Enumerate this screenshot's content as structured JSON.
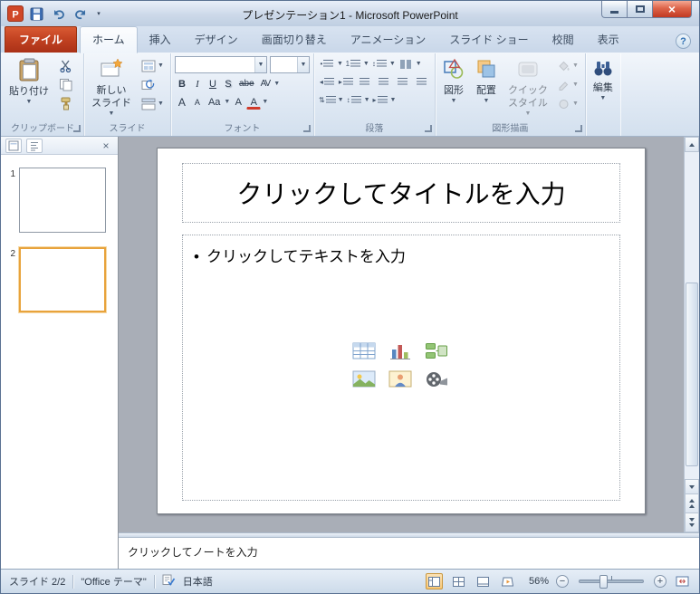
{
  "window": {
    "title": "プレゼンテーション1 - Microsoft PowerPoint"
  },
  "tabs": {
    "file": "ファイル",
    "items": [
      "ホーム",
      "挿入",
      "デザイン",
      "画面切り替え",
      "アニメーション",
      "スライド ショー",
      "校閲",
      "表示"
    ]
  },
  "ribbon": {
    "clipboard": {
      "group_label": "クリップボード",
      "paste_label": "貼り付け"
    },
    "slides": {
      "group_label": "スライド",
      "new_slide_line1": "新しい",
      "new_slide_line2": "スライド"
    },
    "font": {
      "group_label": "フォント",
      "font_name_value": "",
      "font_size_value": "",
      "bold": "B",
      "italic": "I",
      "underline": "U",
      "shadow": "S",
      "strikethrough": "abe",
      "spacing": "AV",
      "grow": "A",
      "shrink": "A",
      "case": "Aa",
      "clear": "A",
      "color": "A"
    },
    "paragraph": {
      "group_label": "段落"
    },
    "drawing": {
      "group_label": "図形描画",
      "shapes_label": "図形",
      "arrange_label": "配置",
      "quick_styles_line1": "クイック",
      "quick_styles_line2": "スタイル"
    },
    "editing": {
      "button_label": "編集"
    }
  },
  "slide_panel": {
    "thumbnails": [
      {
        "number": "1"
      },
      {
        "number": "2"
      }
    ]
  },
  "slide": {
    "title_placeholder": "クリックしてタイトルを入力",
    "bullet": "•",
    "body_placeholder": "クリックしてテキストを入力"
  },
  "notes": {
    "placeholder": "クリックしてノートを入力"
  },
  "statusbar": {
    "slide_indicator": "スライド 2/2",
    "theme_name": "\"Office テーマ\"",
    "language": "日本語",
    "zoom_level": "56%"
  }
}
